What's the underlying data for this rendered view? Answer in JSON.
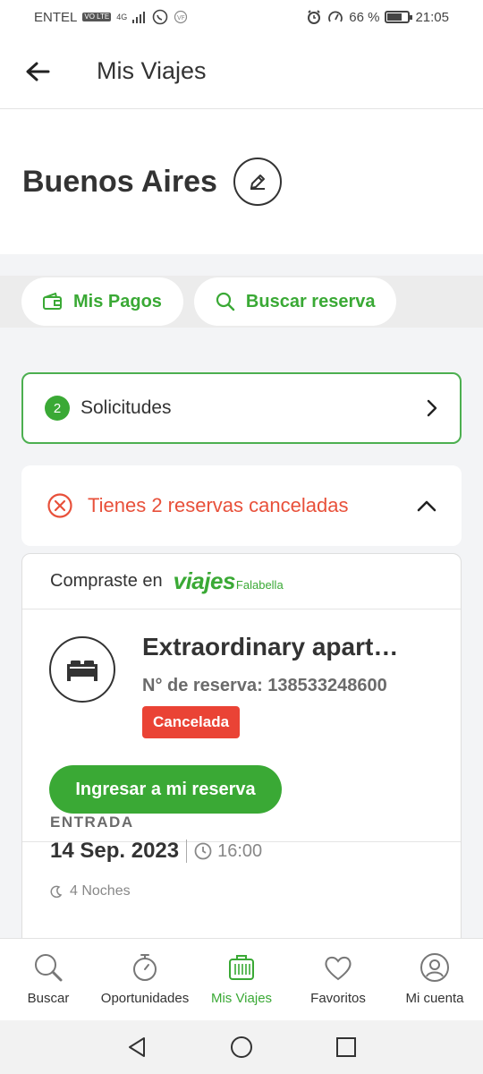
{
  "status_bar": {
    "carrier": "ENTEL",
    "volte": "VO LTE",
    "network": "4G",
    "battery": "66 %",
    "battery_level": 0.66,
    "time": "21:05"
  },
  "app_bar": {
    "title": "Mis Viajes"
  },
  "destination": {
    "title": "Buenos Aires"
  },
  "actions": {
    "payments": "Mis Pagos",
    "search": "Buscar reserva"
  },
  "requests": {
    "count": "2",
    "label": "Solicitudes"
  },
  "cancelled": {
    "message": "Tienes 2 reservas canceladas"
  },
  "booking": {
    "bought_at": "Compraste en",
    "logo_main": "viajes",
    "logo_sub": "Falabella",
    "hotel": "Extraordinary apart…",
    "reservation": "N° de reserva: 138533248600",
    "status": "Cancelada",
    "enter_button": "Ingresar a mi reserva",
    "checkin_label": "ENTRADA",
    "checkin_date": "14 Sep. 2023",
    "checkin_time": "16:00",
    "nights": "4 Noches"
  },
  "bottom_nav": {
    "items": [
      {
        "label": "Buscar",
        "icon": "search-icon"
      },
      {
        "label": "Oportunidades",
        "icon": "stopwatch-icon"
      },
      {
        "label": "Mis Viajes",
        "icon": "luggage-icon"
      },
      {
        "label": "Favoritos",
        "icon": "heart-icon"
      },
      {
        "label": "Mi cuenta",
        "icon": "account-icon"
      }
    ],
    "active": "Mis Viajes"
  },
  "colors": {
    "accent": "#3aa935",
    "danger": "#e8503a",
    "tag": "#ea4335",
    "background": "#f3f4f6"
  }
}
